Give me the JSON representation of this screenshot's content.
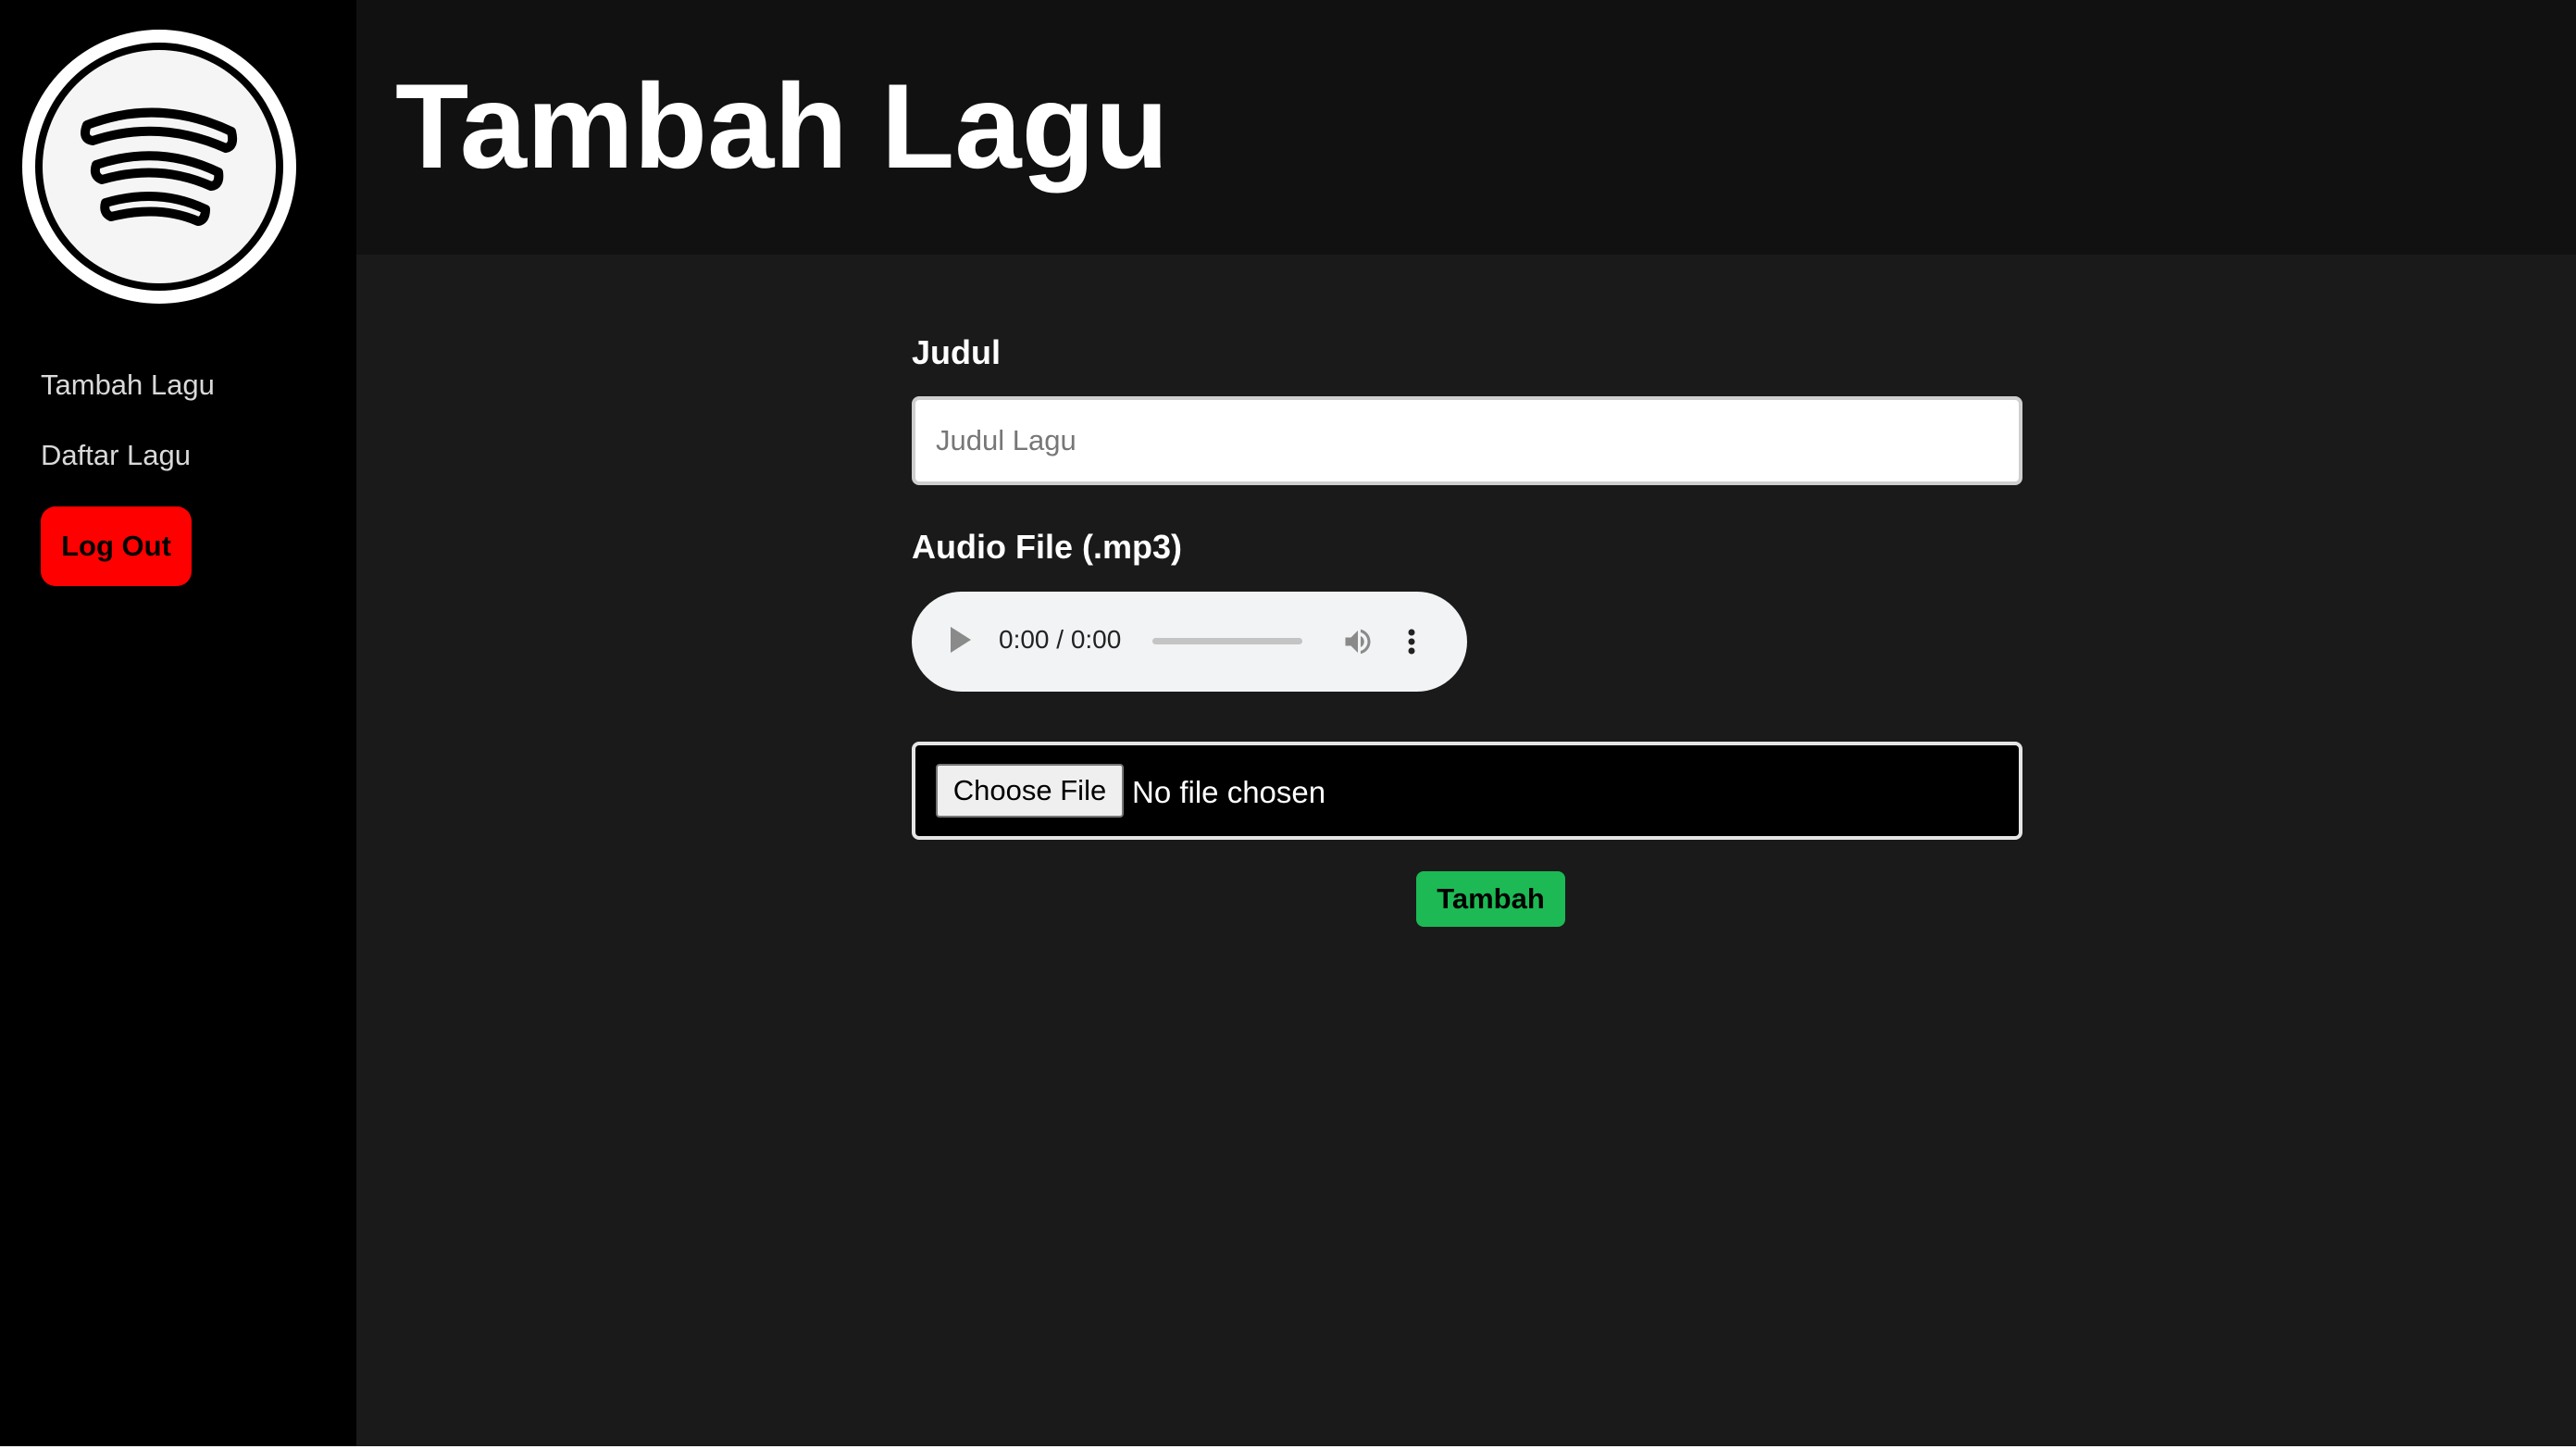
{
  "colors": {
    "sidebar_bg": "#000000",
    "header_bg": "#111111",
    "main_bg": "#1a1a1a",
    "logout_bg": "#ff0000",
    "accent_green": "#1db954",
    "text_white": "#ffffff",
    "nav_text": "#d9d9d9"
  },
  "sidebar": {
    "logo_icon": "spotify-logo-icon",
    "nav": [
      {
        "label": "Tambah Lagu"
      },
      {
        "label": "Daftar Lagu"
      }
    ],
    "logout_label": "Log Out"
  },
  "header": {
    "title": "Tambah Lagu"
  },
  "form": {
    "title_label": "Judul",
    "title_value": "",
    "title_placeholder": "Judul Lagu",
    "audio_label": "Audio File (.mp3)",
    "player": {
      "time": "0:00 / 0:00",
      "progress": 0,
      "icons": [
        "play-icon",
        "volume-icon",
        "more-vertical-icon"
      ]
    },
    "file_button_label": "Choose File",
    "file_status": "No file chosen",
    "submit_label": "Tambah"
  }
}
